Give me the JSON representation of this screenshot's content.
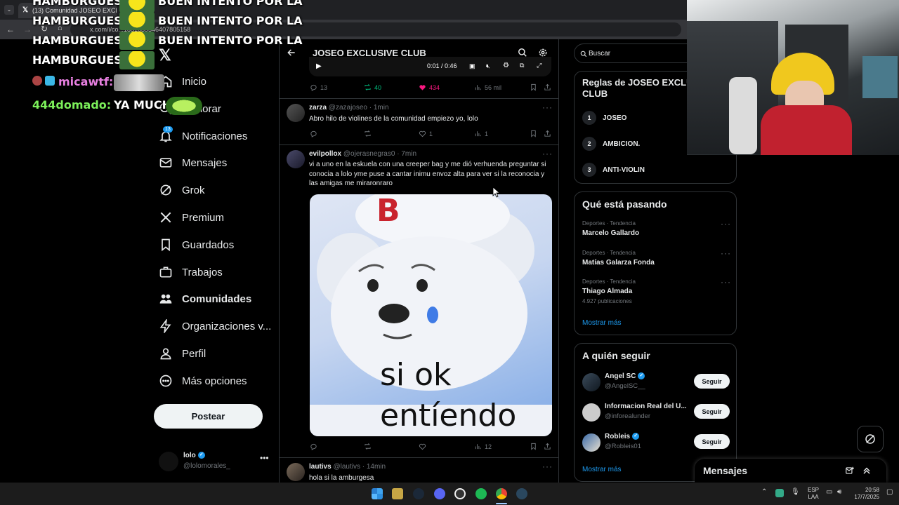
{
  "browser": {
    "tab_title": "(13) Comunidad JOSEO EXCLU",
    "url": "x.com/i/co...1851039546407805158"
  },
  "overlay_chat": [
    {
      "text": "HAMBURGUESA",
      "alert": "BUEN INTENTO POR LA"
    },
    {
      "text": "HAMBURGUESA",
      "alert": "BUEN INTENTO POR LA"
    },
    {
      "text": "HAMBURGUESA",
      "alert": "BUEN INTENTO POR LA"
    },
    {
      "text": "HAMBURGUESA",
      "alert": ""
    }
  ],
  "overlay_user1": "micawtf:",
  "overlay_user2": "444domado:",
  "overlay_msg2": "YA MUCHO",
  "nav": {
    "items": [
      {
        "label": "Inicio",
        "icon": "home-icon"
      },
      {
        "label": "Explorar",
        "icon": "search-icon"
      },
      {
        "label": "Notificaciones",
        "icon": "bell-icon",
        "badge": "13"
      },
      {
        "label": "Mensajes",
        "icon": "mail-icon"
      },
      {
        "label": "Grok",
        "icon": "grok-icon"
      },
      {
        "label": "Premium",
        "icon": "x-logo-icon"
      },
      {
        "label": "Guardados",
        "icon": "bookmark-icon"
      },
      {
        "label": "Trabajos",
        "icon": "briefcase-icon"
      },
      {
        "label": "Comunidades",
        "icon": "people-icon"
      },
      {
        "label": "Organizaciones v...",
        "icon": "lightning-icon"
      },
      {
        "label": "Perfil",
        "icon": "person-icon"
      },
      {
        "label": "Más opciones",
        "icon": "more-circle-icon"
      }
    ],
    "post_label": "Postear",
    "account_name": "lolo",
    "account_handle": "@lolomorales_"
  },
  "header": {
    "title": "JOSEO EXCLUSIVE CLUB"
  },
  "video": {
    "time": "0:01 / 0:46"
  },
  "tweets": [
    {
      "stats": {
        "replies": "13",
        "retweets": "40",
        "likes": "434",
        "views": "56 mil"
      }
    },
    {
      "name": "zarza",
      "handle": "@zazajoseo",
      "time": "· 1min",
      "text": "Abro hilo de violines de la comunidad empiezo yo,  lolo",
      "stats": {
        "replies": "",
        "retweets": "",
        "likes": "1",
        "views": "1"
      }
    },
    {
      "name": "evilpollox",
      "handle": "@ojerasnegras0",
      "time": "· 7min",
      "text": "vi a uno en la eskuela con una creeper bag y me dió verhuenda preguntar si conocia a lolo yme puse a cantar inimu envoz alta para ver si la reconocia y las amigas me miraronraro",
      "image_caption_top": "si ok",
      "image_caption_bottom": "entíendo",
      "image_letter": "B",
      "stats": {
        "replies": "",
        "retweets": "",
        "likes": "",
        "views": "12"
      }
    },
    {
      "name": "lautivs",
      "handle": "@lautivs",
      "time": "· 14min",
      "text": "hola si la amburgesa"
    }
  ],
  "search": {
    "placeholder": "Buscar"
  },
  "rules": {
    "title": "Reglas de JOSEO EXCLUSIVE CLUB",
    "items": [
      {
        "num": "1",
        "text": "JOSEO"
      },
      {
        "num": "2",
        "text": "AMBICION."
      },
      {
        "num": "3",
        "text": "ANTI-VIOLIN"
      }
    ]
  },
  "trends": {
    "title": "Qué está pasando",
    "items": [
      {
        "meta": "Deportes · Tendencia",
        "name": "Marcelo Gallardo",
        "posts": ""
      },
      {
        "meta": "Deportes · Tendencia",
        "name": "Matías Galarza Fonda",
        "posts": ""
      },
      {
        "meta": "Deportes · Tendencia",
        "name": "Thiago Almada",
        "posts": "4.927 publicaciones"
      }
    ],
    "more": "Mostrar más"
  },
  "follow": {
    "title": "A quién seguir",
    "items": [
      {
        "name": "Angel SC",
        "handle": "@AngelSC__",
        "verified": true
      },
      {
        "name": "Informacion Real del U...",
        "handle": "@inforealunder",
        "verified": false
      },
      {
        "name": "Robleis",
        "handle": "@Robleis01",
        "verified": true
      }
    ],
    "button": "Seguir",
    "more": "Mostrar más"
  },
  "messages": {
    "title": "Mensajes"
  },
  "taskbar": {
    "lang1": "ESP",
    "lang2": "LAA",
    "time": "20:58",
    "date": "17/7/2025"
  },
  "colors": {
    "accent": "#1d9bf0",
    "like": "#f91880",
    "retweet": "#00ba7c"
  }
}
